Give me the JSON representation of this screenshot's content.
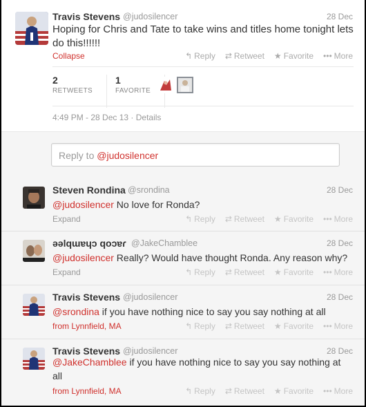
{
  "main_tweet": {
    "name": "Travis Stevens",
    "handle": "@judosilencer",
    "date": "28 Dec",
    "text": "Hoping for Chris and Tate to take wins and titles home tonight lets do this!!!!!!",
    "collapse_label": "Collapse",
    "actions": {
      "reply": "Reply",
      "retweet": "Retweet",
      "favorite": "Favorite",
      "more": "More"
    },
    "retweets_count": "2",
    "retweets_label": "RETWEETS",
    "favorites_count": "1",
    "favorites_label": "FAVORITE",
    "timestamp": "4:49 PM - 28 Dec 13",
    "details_label": "Details"
  },
  "reply_box": {
    "prefix": "Reply to ",
    "mention": "@judosilencer"
  },
  "replies": [
    {
      "name": "Steven Rondina",
      "handle": "@srondina",
      "date": "28 Dec",
      "mention": "@judosilencer",
      "text": " No love for Ronda?",
      "footer": "Expand"
    },
    {
      "name": "ǝǝlqɯɐɥɔ qoɔɐɾ",
      "handle": "@JakeChamblee",
      "date": "28 Dec",
      "mention": "@judosilencer",
      "text": " Really? Would have thought Ronda. Any reason why?",
      "footer": "Expand"
    },
    {
      "name": "Travis Stevens",
      "handle": "@judosilencer",
      "date": "28 Dec",
      "mention": "@srondina",
      "text": " if you have nothing nice to say you say nothing at all",
      "footer": "from Lynnfield, MA"
    },
    {
      "name": "Travis Stevens",
      "handle": "@judosilencer",
      "date": "28 Dec",
      "mention": "@JakeChamblee",
      "text": " if you have nothing nice to say you say nothing at all",
      "footer": "from Lynnfield, MA"
    }
  ],
  "colors": {
    "accent": "#d0312d",
    "muted": "#999999",
    "reply_bg": "#f5f5f5"
  },
  "icons": {
    "reply": "reply-arrow-icon",
    "retweet": "retweet-icon",
    "favorite": "star-icon",
    "more": "ellipsis-icon"
  }
}
